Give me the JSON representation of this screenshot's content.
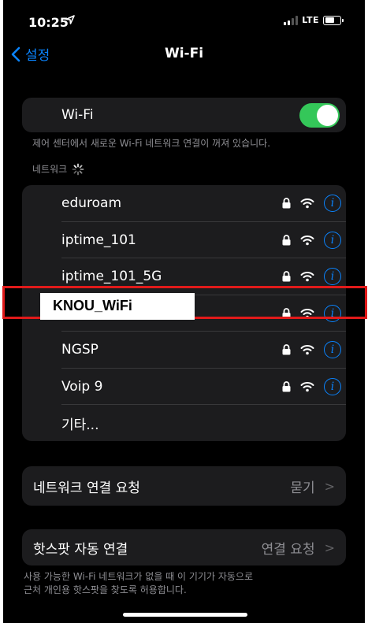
{
  "status_bar": {
    "time": "10:25",
    "carrier": "LTE"
  },
  "nav": {
    "back_label": "설정",
    "title": "Wi-Fi"
  },
  "wifi_toggle": {
    "label": "Wi-Fi",
    "on": true
  },
  "wifi_caption": "제어 센터에서 새로운 Wi-Fi 네트워크 연결이 꺼져 있습니다.",
  "networks_header": "네트워크",
  "networks": [
    {
      "name": "eduroam"
    },
    {
      "name": "iptime_101"
    },
    {
      "name": "iptime_101_5G"
    },
    {
      "name": ""
    },
    {
      "name": "NGSP"
    },
    {
      "name": "Voip 9"
    }
  ],
  "other_label": "기타...",
  "ask_to_join": {
    "label": "네트워크 연결 요청",
    "value": "묻기"
  },
  "auto_hotspot": {
    "label": "핫스팟 자동 연결",
    "value": "연결 요청"
  },
  "hotspot_caption_line1": "사용 가능한 Wi-Fi 네트워크가 없을 때 이 기기가 자동으로",
  "hotspot_caption_line2": "근처 개인용 핫스팟을 찾도록 허용합니다.",
  "highlight_label": "KNOU_WiFi",
  "colors": {
    "accent": "#0a84ff",
    "toggle_on": "#34c759",
    "highlight": "#e11a1a"
  }
}
